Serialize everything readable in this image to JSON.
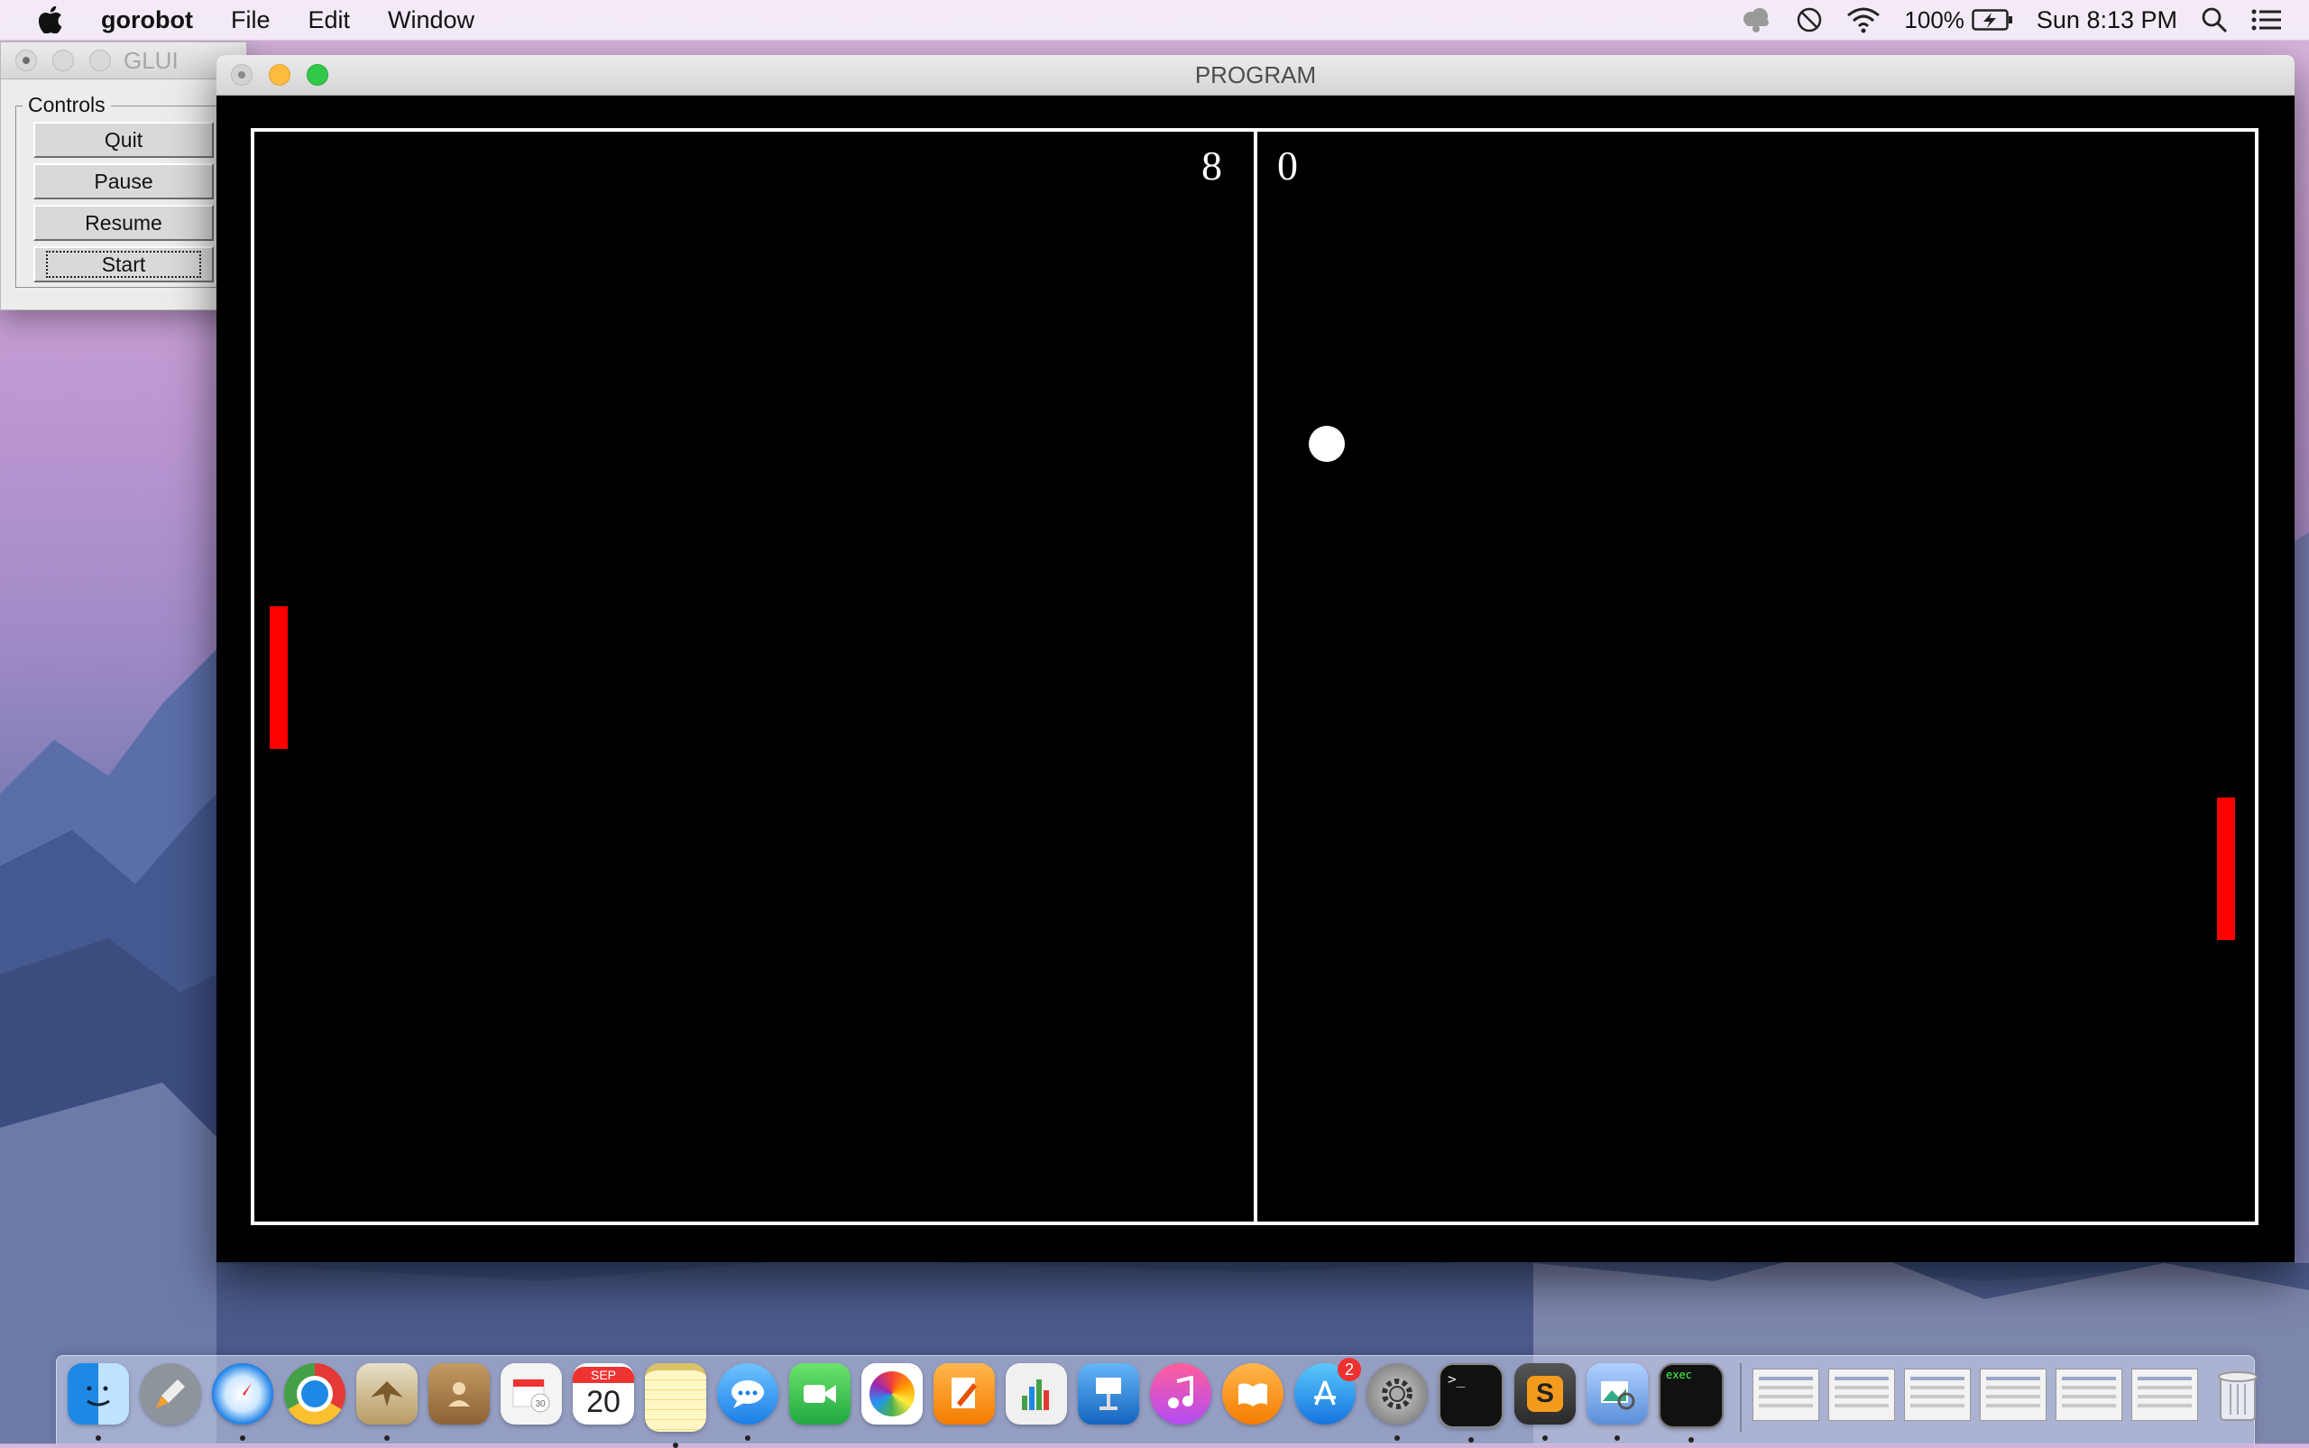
{
  "menubar": {
    "app_name": "gorobot",
    "menus": [
      "File",
      "Edit",
      "Window"
    ],
    "battery": "100%",
    "clock": "Sun 8:13 PM",
    "icons": [
      "apple-logo-icon",
      "creative-cloud-icon",
      "do-not-disturb-icon",
      "wifi-icon",
      "battery-charging-icon",
      "spotlight-search-icon",
      "notification-center-icon"
    ]
  },
  "glui": {
    "title": "GLUI",
    "panel_label": "Controls",
    "buttons": [
      "Quit",
      "Pause",
      "Resume",
      "Start"
    ]
  },
  "program": {
    "title": "PROGRAM",
    "score_left": "8",
    "score_right": "0",
    "colors": {
      "background": "#000000",
      "paddle": "#ff0000",
      "ball": "#ffffff",
      "lines": "#ffffff"
    }
  },
  "dock": {
    "apps": [
      "Finder",
      "Launchpad",
      "Safari",
      "Chrome",
      "Mail",
      "Contacts",
      "Calendar",
      "Notes",
      "Messages",
      "FaceTime",
      "Photos",
      "Pages",
      "Numbers",
      "Keynote",
      "iTunes",
      "iBooks",
      "App Store",
      "System Preferences",
      "Terminal",
      "Sublime Text",
      "Preview",
      "exec"
    ],
    "calendar_month": "SEP",
    "calendar_day": "20",
    "app_store_badge": "2",
    "exec_label": "exec"
  }
}
